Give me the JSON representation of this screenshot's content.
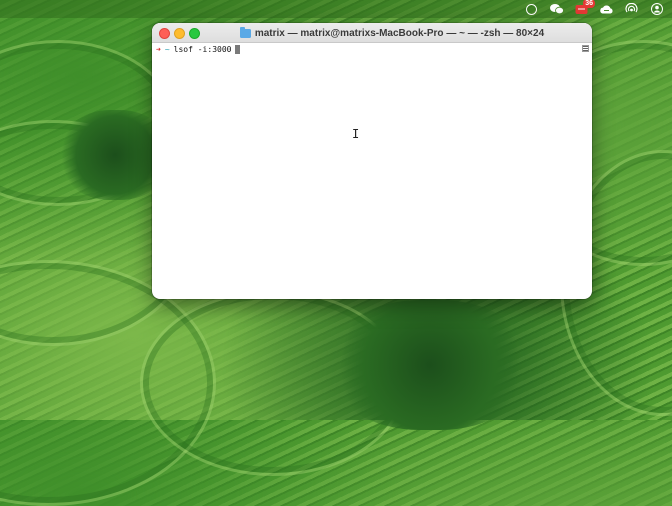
{
  "menubar": {
    "icons": [
      "circle-status-icon",
      "wechat-icon",
      "notification-icon",
      "cloud-sync-icon",
      "airdrop-icon",
      "user-icon"
    ],
    "badge_count": "36"
  },
  "window": {
    "title": "matrix — matrix@matrixs-MacBook-Pro — ~ — -zsh — 80×24",
    "prompt_arrow": "➜",
    "prompt_dir": "~",
    "command": "lsof -i:3000"
  },
  "colors": {
    "prompt_arrow": "#d62b2b",
    "prompt_dir": "#2aa1b3",
    "close": "#fe5f57",
    "minimize": "#febc2e",
    "zoom": "#28c840"
  }
}
